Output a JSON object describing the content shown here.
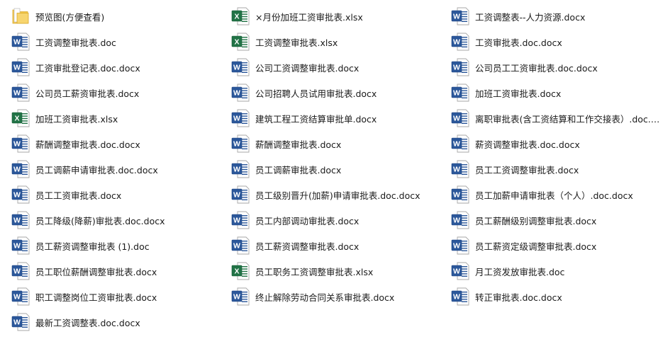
{
  "colors": {
    "word_blue": "#2b579a",
    "word_blue_dark": "#1e4684",
    "excel_green": "#217346",
    "excel_green_dark": "#185c37",
    "folder_yellow": "#f5c94c"
  },
  "columns": [
    {
      "items": [
        {
          "name": "预览图(方便查看)",
          "icon": "folder-icon"
        },
        {
          "name": "工资调整审批表.doc",
          "icon": "word-doc-icon"
        },
        {
          "name": "工资审批登记表.doc.docx",
          "icon": "word-doc-icon"
        },
        {
          "name": "公司员工薪资审批表.docx",
          "icon": "word-doc-icon"
        },
        {
          "name": "加班工资审批表.xlsx",
          "icon": "excel-doc-icon"
        },
        {
          "name": "薪酬调整审批表.doc.docx",
          "icon": "word-doc-icon"
        },
        {
          "name": "员工调薪申请审批表.doc.docx",
          "icon": "word-doc-icon"
        },
        {
          "name": "员工工资审批表.docx",
          "icon": "word-doc-icon"
        },
        {
          "name": "员工降级(降薪)审批表.doc.docx",
          "icon": "word-doc-icon"
        },
        {
          "name": "员工薪资调整审批表 (1).doc",
          "icon": "word-doc-icon"
        },
        {
          "name": "员工职位薪酬调整审批表.docx",
          "icon": "word-doc-icon"
        },
        {
          "name": "职工调整岗位工资审批表.docx",
          "icon": "word-doc-icon"
        },
        {
          "name": "最新工资调整表.doc.docx",
          "icon": "word-doc-icon"
        }
      ]
    },
    {
      "items": [
        {
          "name": "×月份加班工资审批表.xlsx",
          "icon": "excel-doc-icon"
        },
        {
          "name": "工资调整审批表.xlsx",
          "icon": "excel-doc-icon"
        },
        {
          "name": "公司工资调整审批表.docx",
          "icon": "word-doc-icon"
        },
        {
          "name": "公司招聘人员试用审批表.docx",
          "icon": "word-doc-icon"
        },
        {
          "name": "建筑工程工资结算审批单.docx",
          "icon": "word-doc-icon"
        },
        {
          "name": "薪酬调整审批表.docx",
          "icon": "word-doc-icon"
        },
        {
          "name": "员工调薪审批表.docx",
          "icon": "word-doc-icon"
        },
        {
          "name": "员工级别晋升(加薪)申请审批表.doc.docx",
          "icon": "word-doc-icon"
        },
        {
          "name": "员工内部调动审批表.docx",
          "icon": "word-doc-icon"
        },
        {
          "name": "员工薪资调整审批表.docx",
          "icon": "word-doc-icon"
        },
        {
          "name": "员工职务工资调整审批表.xlsx",
          "icon": "excel-doc-icon"
        },
        {
          "name": "终止解除劳动合同关系审批表.docx",
          "icon": "word-doc-icon"
        }
      ]
    },
    {
      "items": [
        {
          "name": "工资调整表--人力资源.docx",
          "icon": "word-doc-icon"
        },
        {
          "name": "工资审批表.doc.docx",
          "icon": "word-doc-icon"
        },
        {
          "name": "公司员工工资审批表.doc.docx",
          "icon": "word-doc-icon"
        },
        {
          "name": "加班工资审批表.docx",
          "icon": "word-doc-icon"
        },
        {
          "name": "离职审批表(含工资结算和工作交接表）.doc.d...",
          "icon": "word-doc-icon"
        },
        {
          "name": "薪资调整审批表.doc.docx",
          "icon": "word-doc-icon"
        },
        {
          "name": "员工工资调整审批表.docx",
          "icon": "word-doc-icon"
        },
        {
          "name": "员工加薪申请审批表（个人）.doc.docx",
          "icon": "word-doc-icon"
        },
        {
          "name": "员工薪酬级别调整审批表.docx",
          "icon": "word-doc-icon"
        },
        {
          "name": "员工薪资定级调整审批表.docx",
          "icon": "word-doc-icon"
        },
        {
          "name": "月工资发放审批表.doc",
          "icon": "word-doc-icon"
        },
        {
          "name": "转正审批表.doc.docx",
          "icon": "word-doc-icon"
        }
      ]
    }
  ]
}
